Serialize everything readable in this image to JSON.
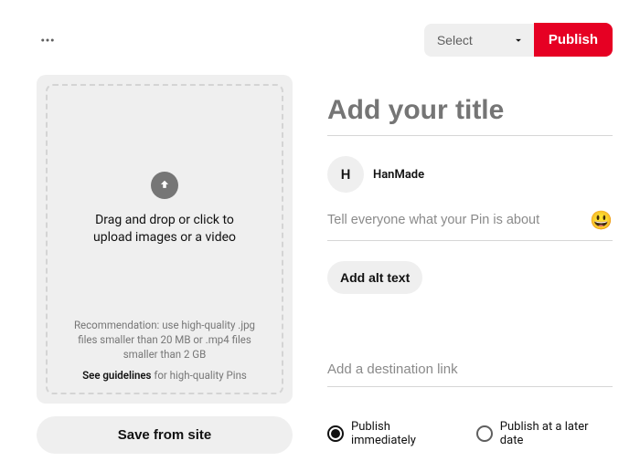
{
  "topbar": {
    "board_select_placeholder": "Select",
    "publish_label": "Publish"
  },
  "upload": {
    "main_text": "Drag and drop or click to upload images or a video",
    "recommendation": "Recommendation: use high-quality .jpg files smaller than 20 MB or .mp4 files smaller than 2 GB",
    "guidelines_prefix": "See guidelines",
    "guidelines_suffix": " for high-quality Pins",
    "save_from_site_label": "Save from site"
  },
  "form": {
    "title_placeholder": "Add your title",
    "description_placeholder": "Tell everyone what your Pin is about",
    "alt_text_label": "Add alt text",
    "link_placeholder": "Add a destination link"
  },
  "user": {
    "avatar_initial": "H",
    "display_name": "HanMade"
  },
  "publish_options": {
    "immediate_label": "Publish immediately",
    "later_label": "Publish at a later date",
    "selected": "immediate"
  }
}
